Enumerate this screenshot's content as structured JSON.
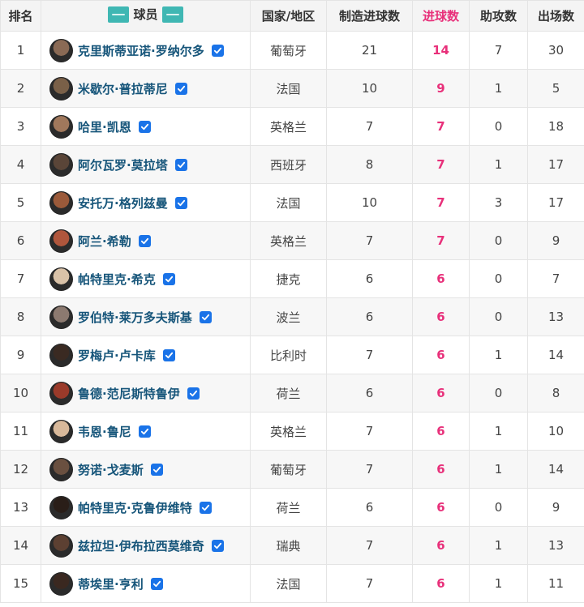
{
  "header": {
    "rank": "排名",
    "player": "球员",
    "country": "国家/地区",
    "created": "制造进球数",
    "goals": "进球数",
    "assists": "助攻数",
    "apps": "出场数"
  },
  "colors": {
    "accent_pink": "#e8307a",
    "name_blue": "#16557a",
    "check_blue": "#1a73e8",
    "logo_teal": "#3fb7b3"
  },
  "rows": [
    {
      "rank": "1",
      "name": "克里斯蒂亚诺·罗纳尔多",
      "country": "葡萄牙",
      "created": "21",
      "goals": "14",
      "assists": "7",
      "apps": "30",
      "avatar": "#8a6a55"
    },
    {
      "rank": "2",
      "name": "米歇尔·普拉蒂尼",
      "country": "法国",
      "created": "10",
      "goals": "9",
      "assists": "1",
      "apps": "5",
      "avatar": "#7a6048"
    },
    {
      "rank": "3",
      "name": "哈里·凯恩",
      "country": "英格兰",
      "created": "7",
      "goals": "7",
      "assists": "0",
      "apps": "18",
      "avatar": "#a0785c"
    },
    {
      "rank": "4",
      "name": "阿尔瓦罗·莫拉塔",
      "country": "西班牙",
      "created": "8",
      "goals": "7",
      "assists": "1",
      "apps": "17",
      "avatar": "#5a4538"
    },
    {
      "rank": "5",
      "name": "安托万·格列兹曼",
      "country": "法国",
      "created": "10",
      "goals": "7",
      "assists": "3",
      "apps": "17",
      "avatar": "#9b5a3a"
    },
    {
      "rank": "6",
      "name": "阿兰·希勒",
      "country": "英格兰",
      "created": "7",
      "goals": "7",
      "assists": "0",
      "apps": "9",
      "avatar": "#b0563c"
    },
    {
      "rank": "7",
      "name": "帕特里克·希克",
      "country": "捷克",
      "created": "6",
      "goals": "6",
      "assists": "0",
      "apps": "7",
      "avatar": "#d9c2a8"
    },
    {
      "rank": "8",
      "name": "罗伯特·莱万多夫斯基",
      "country": "波兰",
      "created": "6",
      "goals": "6",
      "assists": "0",
      "apps": "13",
      "avatar": "#8c7a70"
    },
    {
      "rank": "9",
      "name": "罗梅卢·卢卡库",
      "country": "比利时",
      "created": "7",
      "goals": "6",
      "assists": "1",
      "apps": "14",
      "avatar": "#3a2a22"
    },
    {
      "rank": "10",
      "name": "鲁德·范尼斯特鲁伊",
      "country": "荷兰",
      "created": "6",
      "goals": "6",
      "assists": "0",
      "apps": "8",
      "avatar": "#9a3a2a"
    },
    {
      "rank": "11",
      "name": "韦恩·鲁尼",
      "country": "英格兰",
      "created": "7",
      "goals": "6",
      "assists": "1",
      "apps": "10",
      "avatar": "#d8b89a"
    },
    {
      "rank": "12",
      "name": "努诺·戈麦斯",
      "country": "葡萄牙",
      "created": "7",
      "goals": "6",
      "assists": "1",
      "apps": "14",
      "avatar": "#6a5040"
    },
    {
      "rank": "13",
      "name": "帕特里克·克鲁伊维特",
      "country": "荷兰",
      "created": "6",
      "goals": "6",
      "assists": "0",
      "apps": "9",
      "avatar": "#2a1e18"
    },
    {
      "rank": "14",
      "name": "兹拉坦·伊布拉西莫维奇",
      "country": "瑞典",
      "created": "7",
      "goals": "6",
      "assists": "1",
      "apps": "13",
      "avatar": "#5c4032"
    },
    {
      "rank": "15",
      "name": "蒂埃里·亨利",
      "country": "法国",
      "created": "7",
      "goals": "6",
      "assists": "1",
      "apps": "11",
      "avatar": "#3a2820"
    }
  ]
}
